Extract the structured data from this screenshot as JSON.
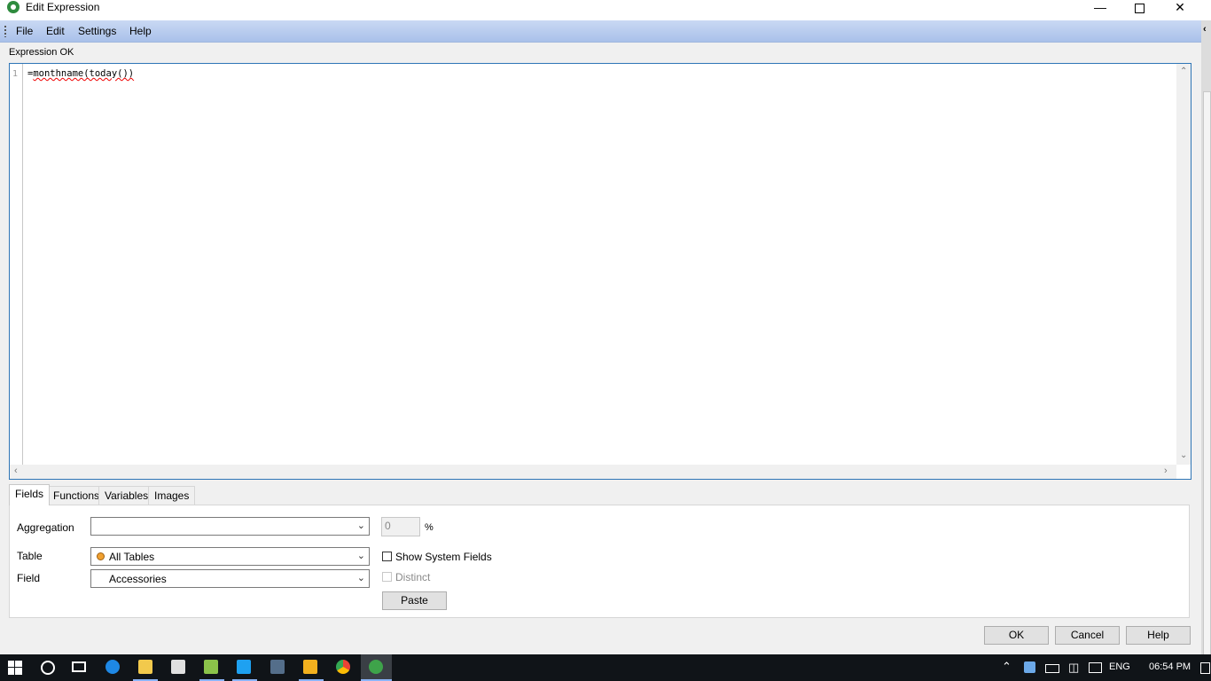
{
  "window": {
    "title": "Edit Expression"
  },
  "menu": {
    "items": [
      "File",
      "Edit",
      "Settings",
      "Help"
    ]
  },
  "status": {
    "text": "Expression OK"
  },
  "editor": {
    "line_number": "1",
    "code_prefix": "=",
    "code_body": "monthname(today())"
  },
  "tabs": [
    "Fields",
    "Functions",
    "Variables",
    "Images"
  ],
  "fields_panel": {
    "aggregation_label": "Aggregation",
    "aggregation_value": "",
    "percent_value": "0",
    "percent_sign": "%",
    "table_label": "Table",
    "table_value": "All Tables",
    "field_label": "Field",
    "field_value": "Accessories",
    "show_system_fields_label": "Show System Fields",
    "distinct_label": "Distinct",
    "paste_label": "Paste"
  },
  "footer": {
    "ok_label": "OK",
    "cancel_label": "Cancel",
    "help_label": "Help"
  },
  "taskbar": {
    "language": "ENG",
    "time": "06:54 PM",
    "icons": [
      "windows-start-icon",
      "cortana-icon",
      "task-view-icon",
      "edge-icon",
      "file-explorer-icon",
      "store-icon",
      "folder-sync-icon",
      "skype-icon",
      "sql-icon",
      "app-yellow-icon",
      "chrome-icon",
      "qlikview-icon"
    ]
  },
  "colors": {
    "accent": "#2e75b6",
    "menubar": "#b9cdee",
    "taskbar": "#101418"
  }
}
